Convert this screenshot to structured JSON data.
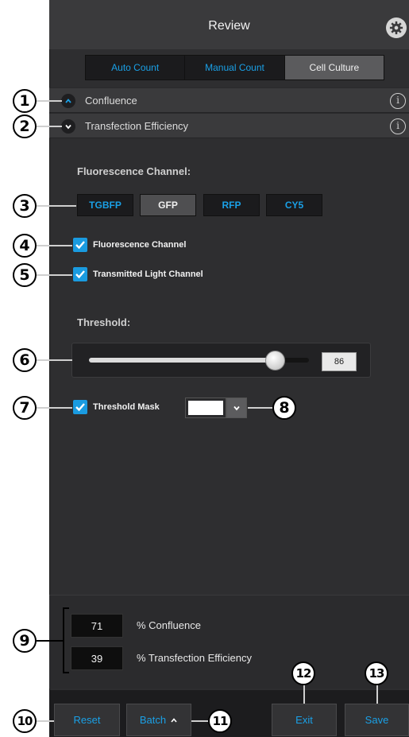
{
  "header": {
    "title": "Review",
    "settings_icon": "gear-icon"
  },
  "tabs": [
    {
      "label": "Auto Count",
      "active": false
    },
    {
      "label": "Manual Count",
      "active": false
    },
    {
      "label": "Cell Culture",
      "active": true
    }
  ],
  "sections": {
    "confluence": {
      "label": "Confluence",
      "expanded": false,
      "icon": "chevron-up-icon"
    },
    "transfection": {
      "label": "Transfection Efficiency",
      "expanded": true,
      "icon": "chevron-down-icon"
    },
    "info_icon_text": "i"
  },
  "fluorescence": {
    "heading": "Fluorescence Channel:",
    "channels": [
      {
        "label": "TGBFP",
        "active": false
      },
      {
        "label": "GFP",
        "active": true
      },
      {
        "label": "RFP",
        "active": false
      },
      {
        "label": "CY5",
        "active": false
      }
    ]
  },
  "checkboxes": {
    "fluorescence_channel": {
      "label": "Fluorescence Channel",
      "checked": true
    },
    "transmitted_light": {
      "label": "Transmitted Light Channel",
      "checked": true
    },
    "threshold_mask": {
      "label": "Threshold Mask",
      "checked": true
    }
  },
  "threshold": {
    "heading": "Threshold:",
    "value": "86",
    "slider_fraction": 0.86
  },
  "mask_color": "#ffffff",
  "results": {
    "confluence": {
      "value": "71",
      "label": "% Confluence"
    },
    "transfection": {
      "value": "39",
      "label": "% Transfection Efficiency"
    }
  },
  "footer": {
    "reset": "Reset",
    "batch": "Batch",
    "exit": "Exit",
    "save": "Save"
  },
  "callouts": [
    "1",
    "2",
    "3",
    "4",
    "5",
    "6",
    "7",
    "8",
    "9",
    "10",
    "11",
    "12",
    "13"
  ],
  "colors": {
    "accent": "#1aa0e6",
    "panel": "#2e2e30",
    "checkbox": "#1a9be0"
  }
}
